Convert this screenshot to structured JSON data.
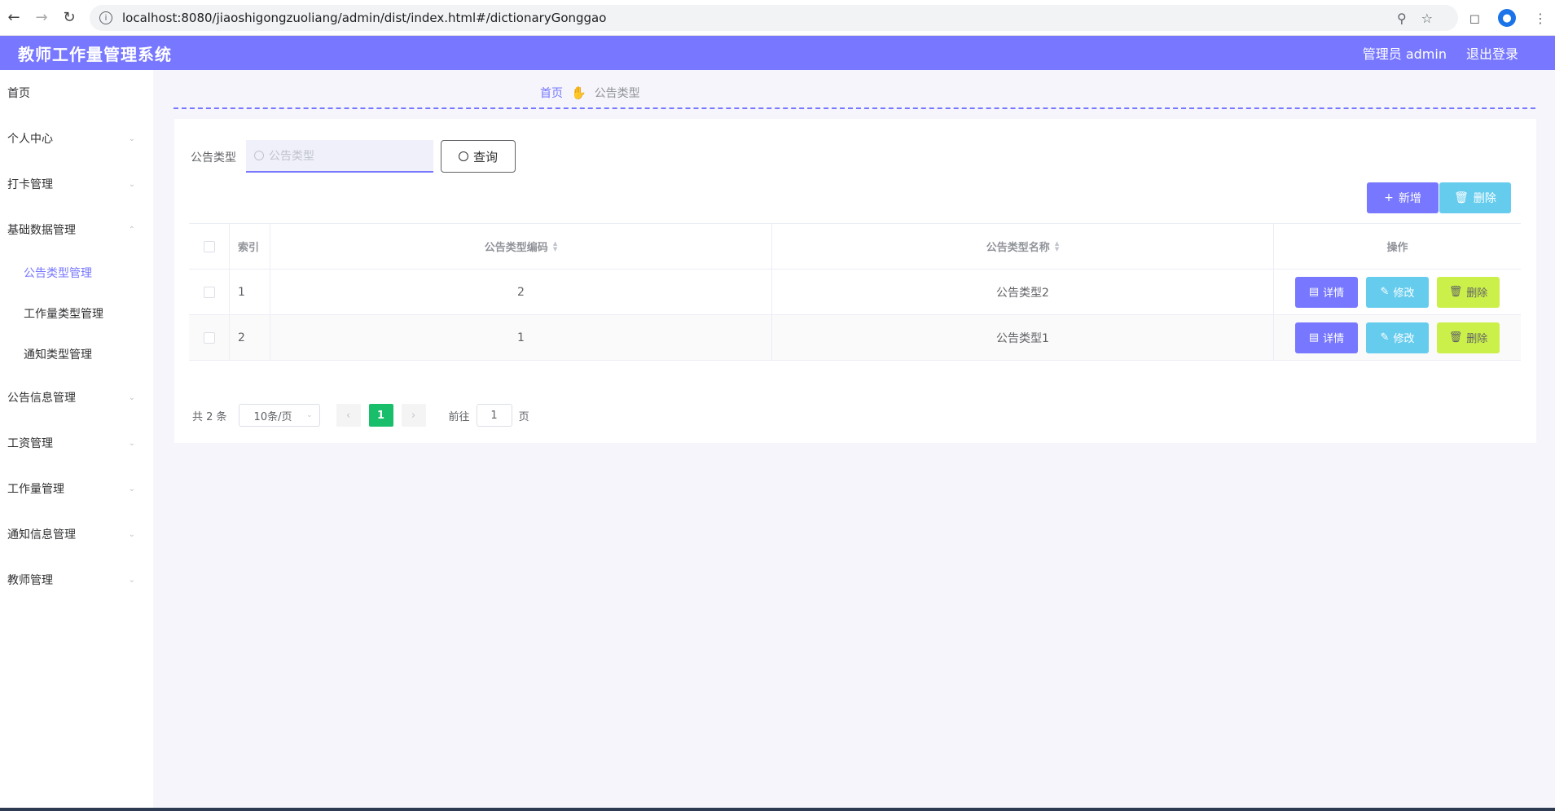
{
  "browser": {
    "url": "localhost:8080/jiaoshigongzuoliang/admin/dist/index.html#/dictionaryGonggao"
  },
  "header": {
    "title": "教师工作量管理系统",
    "user": "管理员 admin",
    "logout": "退出登录"
  },
  "sidebar": {
    "home": "首页",
    "items": [
      {
        "label": "个人中心"
      },
      {
        "label": "打卡管理"
      },
      {
        "label": "基础数据管理"
      },
      {
        "label": "公告信息管理"
      },
      {
        "label": "工资管理"
      },
      {
        "label": "工作量管理"
      },
      {
        "label": "通知信息管理"
      },
      {
        "label": "教师管理"
      }
    ],
    "subitems": [
      {
        "label": "公告类型管理",
        "active": true
      },
      {
        "label": "工作量类型管理"
      },
      {
        "label": "通知类型管理"
      }
    ]
  },
  "breadcrumb": {
    "home": "首页",
    "current": "公告类型"
  },
  "search": {
    "label": "公告类型",
    "placeholder": "公告类型",
    "button": "查询"
  },
  "actions": {
    "add": "新增",
    "delete": "删除"
  },
  "table": {
    "columns": [
      "索引",
      "公告类型编码",
      "公告类型名称",
      "操作"
    ],
    "rows": [
      {
        "index": "1",
        "code": "2",
        "name": "公告类型2"
      },
      {
        "index": "2",
        "code": "1",
        "name": "公告类型1"
      }
    ],
    "row_actions": {
      "detail": "详情",
      "edit": "修改",
      "delete": "删除"
    }
  },
  "pagination": {
    "total": "共 2 条",
    "page_size": "10条/页",
    "current_page": "1",
    "goto_label": "前往",
    "goto_value": "1",
    "goto_suffix": "页"
  },
  "colors": {
    "primary": "#7777ff",
    "info": "#66ccee",
    "danger_row": "#ccf04a",
    "page_active": "#19be6b"
  }
}
